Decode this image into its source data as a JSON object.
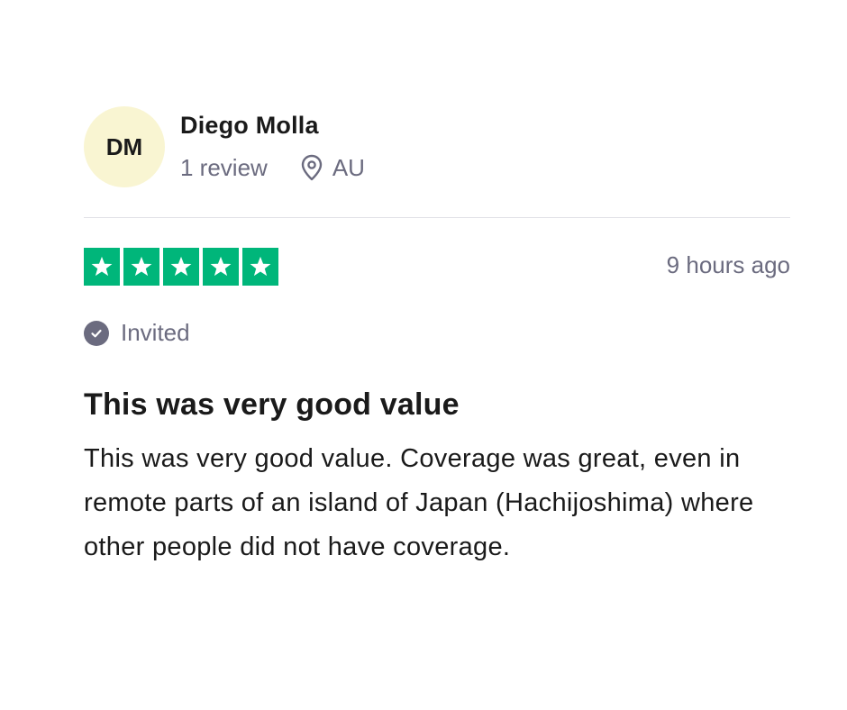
{
  "reviewer": {
    "initials": "DM",
    "name": "Diego Molla",
    "review_count": "1 review",
    "country": "AU",
    "avatar_color": "#f9f5d2"
  },
  "rating": {
    "stars": 5,
    "max_stars": 5,
    "star_color": "#00b67a",
    "time_ago": "9 hours ago"
  },
  "badge": {
    "label": "Invited",
    "icon": "check-circle-icon"
  },
  "review": {
    "title": "This was very good value",
    "body": "This was very good value. Coverage was great, even in remote parts of an island of Japan (Hachijoshima) where other people did not have coverage."
  }
}
